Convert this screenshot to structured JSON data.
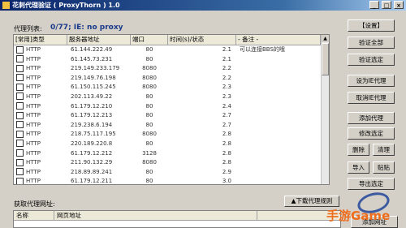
{
  "window": {
    "title": "花刺代理验证 ( ProxyThorn ) 1.0"
  },
  "status": {
    "label": "代理列表:",
    "text": "0/77;   IE: no proxy"
  },
  "table": {
    "columns": [
      "[常用]类型",
      "服务器地址",
      "端口",
      "时间(s)/状态",
      "- 备注 -"
    ],
    "rows": [
      {
        "type": "HTTP",
        "addr": "61.144.222.49",
        "port": "80",
        "time": "2.1",
        "note": "可以连接BBS的哦"
      },
      {
        "type": "HTTP",
        "addr": "61.145.73.231",
        "port": "80",
        "time": "2.1",
        "note": ""
      },
      {
        "type": "HTTP",
        "addr": "219.149.233.179",
        "port": "8080",
        "time": "2.2",
        "note": ""
      },
      {
        "type": "HTTP",
        "addr": "219.149.76.198",
        "port": "8080",
        "time": "2.2",
        "note": ""
      },
      {
        "type": "HTTP",
        "addr": "61.150.115.245",
        "port": "8080",
        "time": "2.3",
        "note": ""
      },
      {
        "type": "HTTP",
        "addr": "202.113.49.22",
        "port": "80",
        "time": "2.3",
        "note": ""
      },
      {
        "type": "HTTP",
        "addr": "61.179.12.210",
        "port": "80",
        "time": "2.4",
        "note": ""
      },
      {
        "type": "HTTP",
        "addr": "61.179.12.213",
        "port": "80",
        "time": "2.7",
        "note": ""
      },
      {
        "type": "HTTP",
        "addr": "219.238.6.194",
        "port": "80",
        "time": "2.7",
        "note": ""
      },
      {
        "type": "HTTP",
        "addr": "218.75.117.195",
        "port": "8080",
        "time": "2.8",
        "note": ""
      },
      {
        "type": "HTTP",
        "addr": "220.189.220.8",
        "port": "80",
        "time": "2.8",
        "note": ""
      },
      {
        "type": "HTTP",
        "addr": "61.179.12.212",
        "port": "3128",
        "time": "2.8",
        "note": ""
      },
      {
        "type": "HTTP",
        "addr": "211.90.132.29",
        "port": "8080",
        "time": "2.8",
        "note": ""
      },
      {
        "type": "HTTP",
        "addr": "218.89.89.241",
        "port": "80",
        "time": "2.9",
        "note": ""
      },
      {
        "type": "HTTP",
        "addr": "61.179.12.211",
        "port": "80",
        "time": "3.0",
        "note": ""
      }
    ]
  },
  "buttons": {
    "settings": "【设置】",
    "verify_all": "验证全部",
    "verify_selected": "验证选定",
    "set_ie_proxy": "设为IE代理",
    "cancel_ie_proxy": "取消IE代理",
    "add_proxy": "添加代理",
    "edit_selected": "修改选定",
    "delete": "删除",
    "clear": "清理",
    "import": "导入",
    "paste": "贴贴",
    "export_selected": "导出选定",
    "add_address": "添加网址"
  },
  "grab": {
    "label": "获取代理网址:",
    "download_rules": "▲下载代理规则",
    "columns": [
      "名称",
      "网页地址"
    ]
  },
  "watermark": "手游Game",
  "colors": {
    "title_bar": "#0a246a",
    "status_text": "#1a3a8a",
    "watermark": "#ef6c1b"
  }
}
